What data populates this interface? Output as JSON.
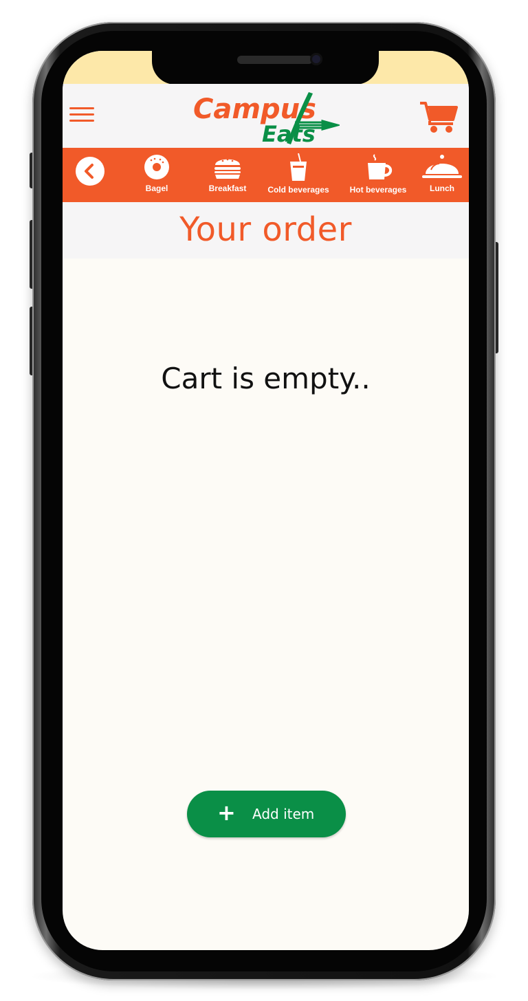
{
  "app": {
    "brand_line1": "Campus",
    "brand_line2": "Eats",
    "colors": {
      "brand_orange": "#f15a29",
      "brand_green": "#0a8f47",
      "status_bar": "#fde8a9",
      "header_bg": "#f6f5f6",
      "content_bg": "#fdfbf6"
    }
  },
  "header": {
    "menu_icon": "hamburger-menu-icon",
    "cart_icon": "shopping-cart-icon"
  },
  "categories": {
    "back_icon": "chevron-left-icon",
    "items": [
      {
        "label": "Bagel",
        "icon": "bagel-icon"
      },
      {
        "label": "Breakfast",
        "icon": "burger-icon"
      },
      {
        "label": "Cold beverages",
        "icon": "cold-drink-icon"
      },
      {
        "label": "Hot beverages",
        "icon": "coffee-cup-icon"
      },
      {
        "label": "Lunch",
        "icon": "cloche-icon"
      }
    ]
  },
  "main": {
    "title": "Your order",
    "empty_message": "Cart is empty..",
    "add_button": {
      "icon": "+",
      "label": "Add item"
    }
  }
}
